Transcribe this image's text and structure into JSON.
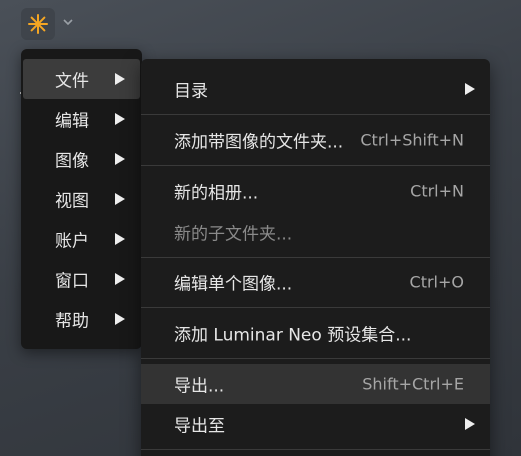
{
  "app": {
    "logo_icon": "luminar-sunburst-icon",
    "logo_color": "#f5a623",
    "menu_chevron_icon": "chevron-down-icon"
  },
  "main_menu": {
    "items": [
      {
        "label": "文件",
        "active": true
      },
      {
        "label": "编辑"
      },
      {
        "label": "图像"
      },
      {
        "label": "视图"
      },
      {
        "label": "账户"
      },
      {
        "label": "窗口"
      },
      {
        "label": "帮助"
      }
    ]
  },
  "file_submenu": {
    "items": [
      {
        "label": "目录",
        "shortcut": "",
        "submenu": true
      },
      {
        "label": "添加带图像的文件夹...",
        "shortcut": "Ctrl+Shift+N"
      },
      {
        "label": "新的相册...",
        "shortcut": "Ctrl+N"
      },
      {
        "label": "新的子文件夹...",
        "shortcut": "",
        "disabled": true
      },
      {
        "label": "编辑单个图像...",
        "shortcut": "Ctrl+O"
      },
      {
        "label": "添加 Luminar Neo 预设集合...",
        "shortcut": ""
      },
      {
        "label": "导出...",
        "shortcut": "Shift+Ctrl+E",
        "hover": true
      },
      {
        "label": "导出至",
        "shortcut": "",
        "submenu": true
      }
    ]
  },
  "colors": {
    "menu_bg": "#181818",
    "submenu_bg": "#1c1c1c",
    "active_bg": "#3c3c3c",
    "hover_bg": "#333333",
    "text": "#e6e6e6",
    "shortcut_text": "#a6a6a6",
    "disabled_text": "#8a8a8a"
  }
}
